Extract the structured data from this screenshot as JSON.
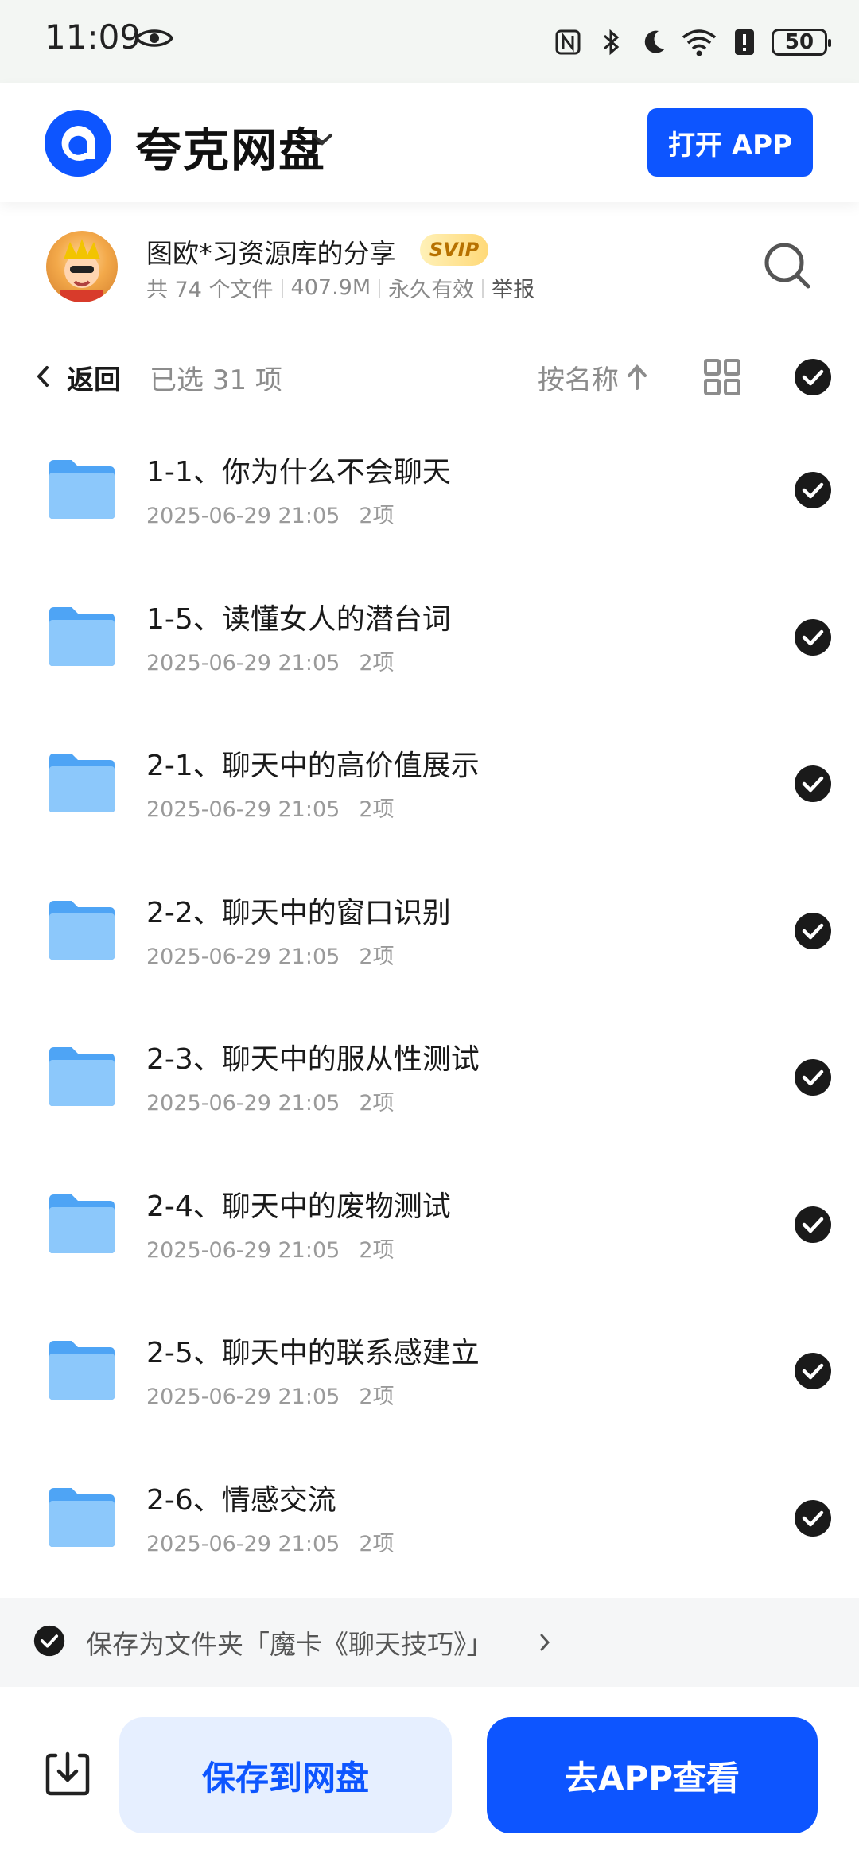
{
  "status_bar": {
    "time": "11:09",
    "battery": "50",
    "icons": [
      "eye-icon",
      "nfc-icon",
      "bluetooth-icon",
      "moon-icon",
      "wifi-icon",
      "alert-icon",
      "battery-icon"
    ]
  },
  "header": {
    "app_name": "夸克网盘",
    "open_app_label": "打开 APP",
    "brand_color": "#0d55ff"
  },
  "share": {
    "title": "图欧*习资源库的分享",
    "badge": "SVIP",
    "file_count": "共 74 个文件",
    "size": "407.9M",
    "validity": "永久有效",
    "report": "举报"
  },
  "toolbar": {
    "back_label": "返回",
    "selected": "已选 31 项",
    "sort_label": "按名称"
  },
  "files": [
    {
      "name": "1-1、你为什么不会聊天",
      "date": "2025-06-29 21:05",
      "count": "2项"
    },
    {
      "name": "1-5、读懂女人的潜台词",
      "date": "2025-06-29 21:05",
      "count": "2项"
    },
    {
      "name": "2-1、聊天中的高价值展示",
      "date": "2025-06-29 21:05",
      "count": "2项"
    },
    {
      "name": "2-2、聊天中的窗口识别",
      "date": "2025-06-29 21:05",
      "count": "2项"
    },
    {
      "name": "2-3、聊天中的服从性测试",
      "date": "2025-06-29 21:05",
      "count": "2项"
    },
    {
      "name": "2-4、聊天中的废物测试",
      "date": "2025-06-29 21:05",
      "count": "2项"
    },
    {
      "name": "2-5、聊天中的联系感建立",
      "date": "2025-06-29 21:05",
      "count": "2项"
    },
    {
      "name": "2-6、情感交流",
      "date": "2025-06-29 21:05",
      "count": "2项"
    }
  ],
  "save_as": {
    "text": "保存为文件夹「魔卡《聊天技巧》」"
  },
  "actions": {
    "save_label": "保存到网盘",
    "go_app_label": "去APP查看"
  }
}
